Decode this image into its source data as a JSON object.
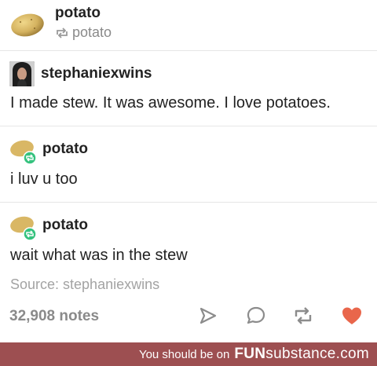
{
  "header": {
    "name": "potato",
    "reblogged_from": "potato"
  },
  "posts": [
    {
      "username": "stephaniexwins",
      "text": "I made stew. It was awesome. I love potatoes."
    },
    {
      "username": "potato",
      "text": "i luv u too"
    },
    {
      "username": "potato",
      "text": "wait what was in the stew"
    }
  ],
  "source": "Source: stephaniexwins",
  "notes": "32,908 notes",
  "actions": {
    "icons": [
      "share-icon",
      "reply-icon",
      "reblog-icon",
      "like-icon"
    ],
    "accent_like": "#e9664b",
    "accent_reblog_badge": "#35c27e"
  },
  "footer": {
    "prefix": "You should be on",
    "brand_bold": "FUN",
    "brand_rest": "substance",
    "brand_suffix": ".com",
    "bg_color": "#9d4f51"
  }
}
